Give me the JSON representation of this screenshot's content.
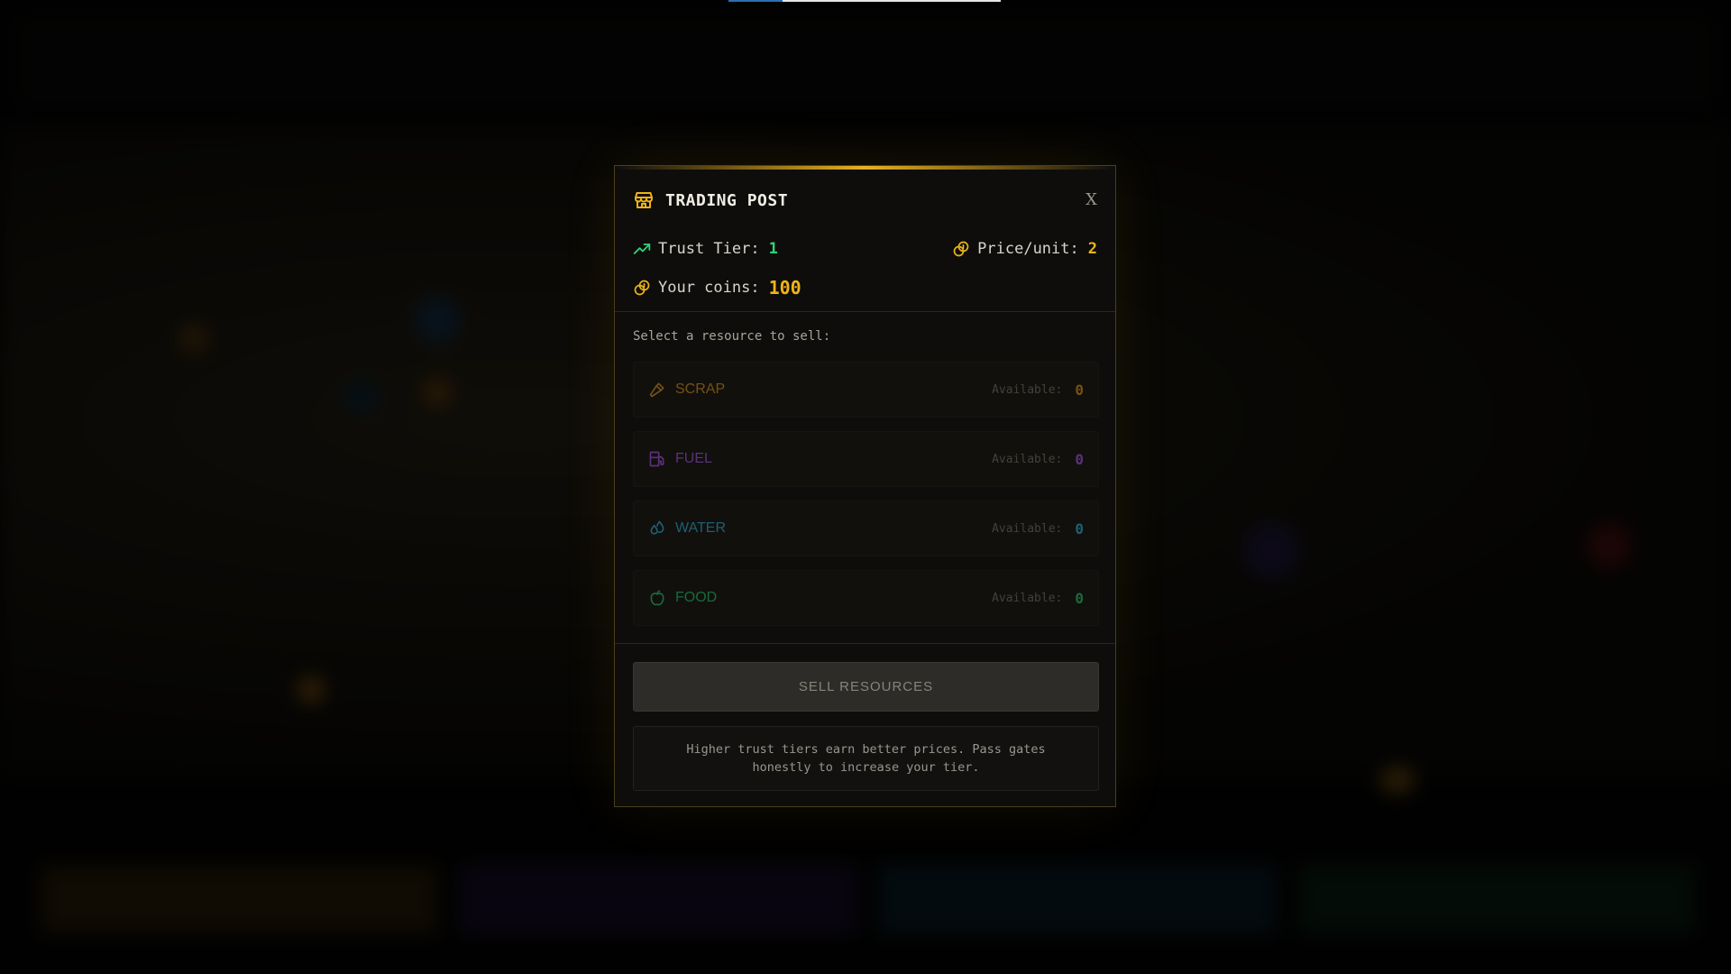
{
  "modal": {
    "title": "TRADING POST",
    "close_label": "X",
    "title_icon": "store-icon",
    "trust_tier_label": "Trust Tier:",
    "trust_tier_value": "1",
    "price_label": "Price/unit:",
    "price_value": "2",
    "coins_label": "Your coins:",
    "coins_value": "100",
    "select_label": "Select a resource to sell:",
    "resources": [
      {
        "name": "SCRAP",
        "available_label": "Available:",
        "available": "0",
        "icon": "hammer-icon",
        "color": "#c98a1a"
      },
      {
        "name": "FUEL",
        "available_label": "Available:",
        "available": "0",
        "icon": "fuel-pump-icon",
        "color": "#9b4dd6"
      },
      {
        "name": "WATER",
        "available_label": "Available:",
        "available": "0",
        "icon": "droplets-icon",
        "color": "#2aa3c8"
      },
      {
        "name": "FOOD",
        "available_label": "Available:",
        "available": "0",
        "icon": "apple-icon",
        "color": "#22b566"
      }
    ],
    "sell_button": "SELL RESOURCES",
    "hint": "Higher trust tiers earn better prices. Pass gates honestly to increase your tier."
  },
  "colors": {
    "accent_gold": "#f0b418",
    "trust_green": "#2fd27a"
  },
  "loading_progress": 0.2
}
